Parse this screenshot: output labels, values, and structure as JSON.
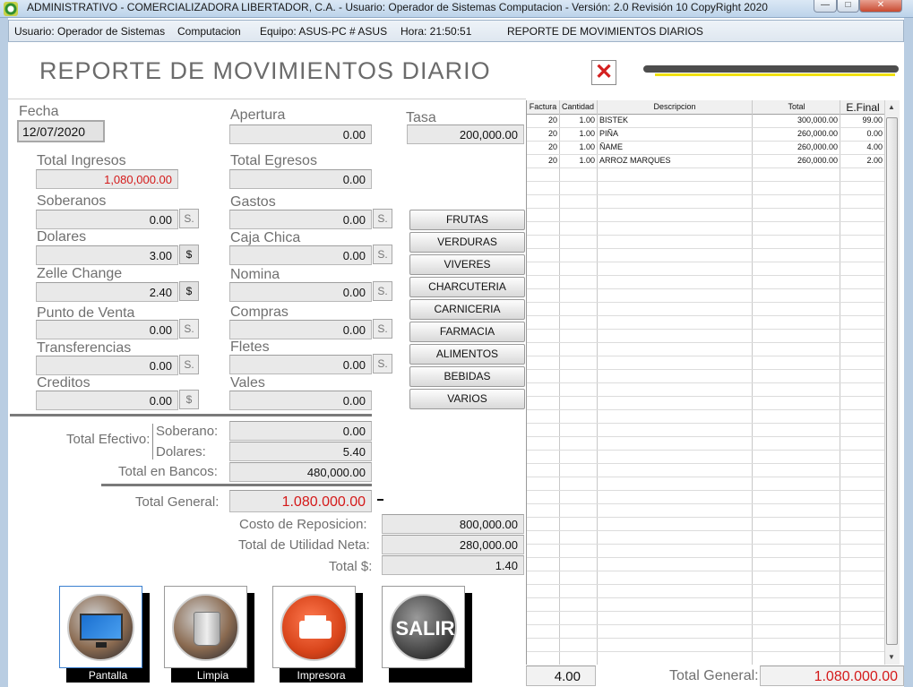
{
  "titlebar": {
    "text": "ADMINISTRATIVO  -  COMERCIALIZADORA LIBERTADOR, C.A.  -  Usuario: Operador de Sistemas      Computacion  -  Versión: 2.0 Revisión 10      CopyRight 2020"
  },
  "status": {
    "usuario": "Usuario: Operador de Sistemas",
    "area": "Computacion",
    "equipo": "Equipo:  ASUS-PC # ASUS",
    "hora": "Hora:  21:50:51",
    "modulo": "REPORTE DE MOVIMIENTOS DIARIOS"
  },
  "page_title": "REPORTE DE MOVIMIENTOS DIARIO",
  "close_icon": "close-icon",
  "fecha": {
    "label": "Fecha",
    "value": "12/07/2020"
  },
  "apertura": {
    "label": "Apertura",
    "value": "0.00"
  },
  "tasa": {
    "label": "Tasa",
    "value": "200,000.00"
  },
  "ingresos": {
    "total_label": "Total Ingresos",
    "total_value": "1,080,000.00",
    "soberanos": {
      "label": "Soberanos",
      "value": "0.00",
      "unit": "S."
    },
    "dolares": {
      "label": "Dolares",
      "value": "3.00",
      "unit": "$"
    },
    "zelle": {
      "label": "Zelle Change",
      "value": "2.40",
      "unit": "$"
    },
    "punto": {
      "label": "Punto de Venta",
      "value": "0.00",
      "unit": "S."
    },
    "transferencias": {
      "label": "Transferencias",
      "value": "0.00",
      "unit": "S."
    },
    "creditos": {
      "label": "Creditos",
      "value": "0.00",
      "unit": "$"
    }
  },
  "egresos": {
    "total_label": "Total Egresos",
    "total_value": "0.00",
    "gastos": {
      "label": "Gastos",
      "value": "0.00",
      "unit": "S."
    },
    "caja_chica": {
      "label": "Caja Chica",
      "value": "0.00",
      "unit": "S."
    },
    "nomina": {
      "label": "Nomina",
      "value": "0.00",
      "unit": "S."
    },
    "compras": {
      "label": "Compras",
      "value": "0.00",
      "unit": "S."
    },
    "fletes": {
      "label": "Fletes",
      "value": "0.00",
      "unit": "S."
    },
    "vales": {
      "label": "Vales",
      "value": "0.00"
    }
  },
  "categories": [
    "FRUTAS",
    "VERDURAS",
    "VIVERES",
    "CHARCUTERIA",
    "CARNICERIA",
    "FARMACIA",
    "ALIMENTOS",
    "BEBIDAS",
    "VARIOS"
  ],
  "totales": {
    "efectivo_label": "Total Efectivo:",
    "soberano_label": "Soberano:",
    "soberano_value": "0.00",
    "dolares_label": "Dolares:",
    "dolares_value": "5.40",
    "bancos_label": "Total en Bancos:",
    "bancos_value": "480,000.00",
    "general_label": "Total General:",
    "general_value": "1.080.000.00",
    "costo_label": "Costo de Reposicion:",
    "costo_value": "800,000.00",
    "utilidad_label": "Total de Utilidad Neta:",
    "utilidad_value": "280,000.00",
    "dolar_label": "Total $:",
    "dolar_value": "1.40"
  },
  "buttons": {
    "pantalla": {
      "label": "Pantalla",
      "icon": "monitor-icon"
    },
    "limpia": {
      "label": "Limpia",
      "icon": "trash-icon"
    },
    "impresora": {
      "label": "Impresora",
      "icon": "printer-icon"
    },
    "salir": {
      "label": "",
      "icon_text": "SALIR"
    }
  },
  "grid": {
    "headers": [
      "Factura",
      "Cantidad",
      "Descripcion",
      "Total",
      "E.Final"
    ],
    "rows": [
      [
        "20",
        "1.00",
        "BISTEK",
        "300,000.00",
        "99.00"
      ],
      [
        "20",
        "1.00",
        "PIÑA",
        "260,000.00",
        "0.00"
      ],
      [
        "20",
        "1.00",
        "ÑAME",
        "260,000.00",
        "4.00"
      ],
      [
        "20",
        "1.00",
        "ARROZ MARQUES",
        "260,000.00",
        "2.00"
      ]
    ]
  },
  "footer": {
    "cantidad_total": "4.00",
    "total_label": "Total General:",
    "total_value": "1.080.000.00"
  }
}
